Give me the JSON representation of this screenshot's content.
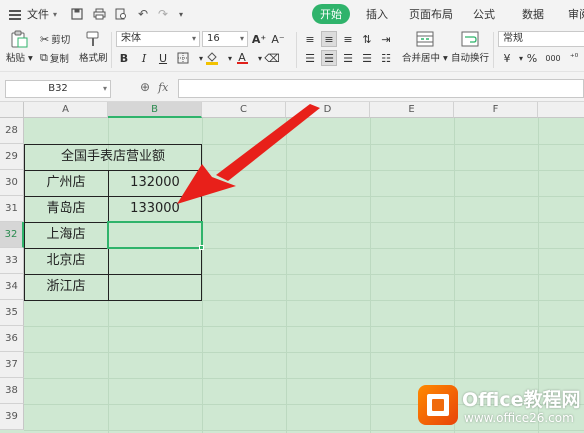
{
  "menubar": {
    "file_label": "文件",
    "tabs": [
      "开始",
      "插入",
      "页面布局",
      "公式",
      "数据",
      "审阅"
    ],
    "active_tab": "开始"
  },
  "ribbon": {
    "paste_label": "粘贴",
    "cut_label": "剪切",
    "copy_label": "复制",
    "format_painter_label": "格式刷",
    "font_name": "宋体",
    "font_size": "16",
    "merge_center_label": "合并居中",
    "wrap_text_label": "自动换行",
    "number_format": "常规",
    "percent_symbol": "%",
    "thousands_symbol": "000"
  },
  "formula_bar": {
    "name_box": "B32",
    "fx_label": "fx",
    "formula": ""
  },
  "sheet": {
    "columns": [
      "A",
      "B",
      "C",
      "D",
      "E",
      "F"
    ],
    "selected_column": "B",
    "rows": [
      "28",
      "29",
      "30",
      "31",
      "32",
      "33",
      "34",
      "35",
      "36",
      "37",
      "38",
      "39"
    ],
    "selected_row": "32",
    "table": {
      "title": "全国手表店营业额",
      "stores": [
        "广州店",
        "青岛店",
        "上海店",
        "北京店",
        "浙江店"
      ],
      "values": [
        "132000",
        "133000",
        "",
        "",
        ""
      ]
    }
  },
  "annotation": {
    "arrow_color": "#e8201a"
  },
  "watermark": {
    "title": "Office教程网",
    "url": "www.office26.com"
  },
  "colors": {
    "accent": "#2fb36b",
    "sheet_bg": "#cfe8d2"
  }
}
